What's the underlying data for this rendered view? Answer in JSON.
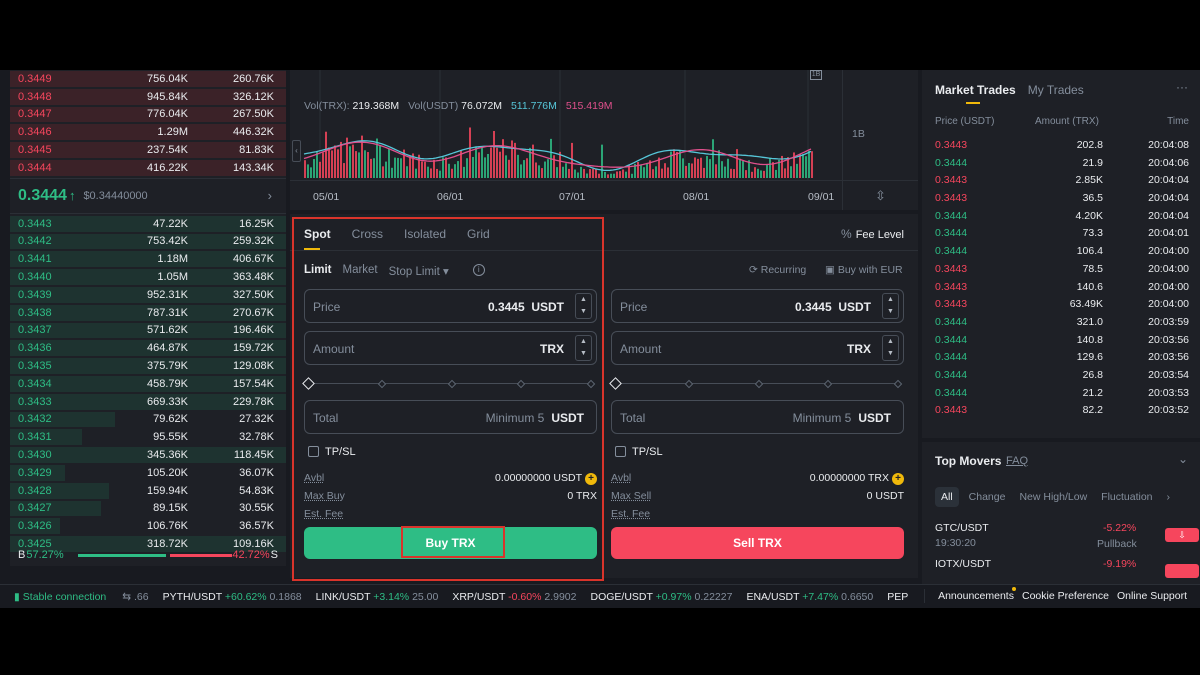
{
  "colors": {
    "buy": "#2ebd85",
    "sell": "#f6465d",
    "accent": "#f0b90b",
    "bg": "#181a20",
    "panel": "#1e2026",
    "highlight": "#d9342b"
  },
  "orderbook": {
    "asks": [
      {
        "price": "0.3449",
        "amount": "756.04K",
        "total": "260.76K",
        "depth": 1.0
      },
      {
        "price": "0.3448",
        "amount": "945.84K",
        "total": "326.12K",
        "depth": 1.0
      },
      {
        "price": "0.3447",
        "amount": "776.04K",
        "total": "267.50K",
        "depth": 1.0
      },
      {
        "price": "0.3446",
        "amount": "1.29M",
        "total": "446.32K",
        "depth": 1.0
      },
      {
        "price": "0.3445",
        "amount": "237.54K",
        "total": "81.83K",
        "depth": 1.0
      },
      {
        "price": "0.3444",
        "amount": "416.22K",
        "total": "143.34K",
        "depth": 1.0
      }
    ],
    "mid": {
      "price": "0.3444",
      "arrow": "↑",
      "usd": "$0.34440000",
      "chevron": "›"
    },
    "bids": [
      {
        "price": "0.3443",
        "amount": "47.22K",
        "total": "16.25K",
        "depth": 1.0
      },
      {
        "price": "0.3442",
        "amount": "753.42K",
        "total": "259.32K",
        "depth": 1.0
      },
      {
        "price": "0.3441",
        "amount": "1.18M",
        "total": "406.67K",
        "depth": 1.0
      },
      {
        "price": "0.3440",
        "amount": "1.05M",
        "total": "363.48K",
        "depth": 1.0
      },
      {
        "price": "0.3439",
        "amount": "952.31K",
        "total": "327.50K",
        "depth": 1.0
      },
      {
        "price": "0.3438",
        "amount": "787.31K",
        "total": "270.67K",
        "depth": 1.0
      },
      {
        "price": "0.3437",
        "amount": "571.62K",
        "total": "196.46K",
        "depth": 1.0
      },
      {
        "price": "0.3436",
        "amount": "464.87K",
        "total": "159.72K",
        "depth": 1.0
      },
      {
        "price": "0.3435",
        "amount": "375.79K",
        "total": "129.08K",
        "depth": 1.0
      },
      {
        "price": "0.3434",
        "amount": "458.79K",
        "total": "157.54K",
        "depth": 1.0
      },
      {
        "price": "0.3433",
        "amount": "669.33K",
        "total": "229.78K",
        "depth": 1.0
      },
      {
        "price": "0.3432",
        "amount": "79.62K",
        "total": "27.32K",
        "depth": 0.38
      },
      {
        "price": "0.3431",
        "amount": "95.55K",
        "total": "32.78K",
        "depth": 0.26
      },
      {
        "price": "0.3430",
        "amount": "345.36K",
        "total": "118.45K",
        "depth": 1.0
      },
      {
        "price": "0.3429",
        "amount": "105.20K",
        "total": "36.07K",
        "depth": 0.2
      },
      {
        "price": "0.3428",
        "amount": "159.94K",
        "total": "54.83K",
        "depth": 0.36
      },
      {
        "price": "0.3427",
        "amount": "89.15K",
        "total": "30.55K",
        "depth": 0.33
      },
      {
        "price": "0.3426",
        "amount": "106.76K",
        "total": "36.57K",
        "depth": 0.18
      },
      {
        "price": "0.3425",
        "amount": "318.72K",
        "total": "109.16K",
        "depth": 1.0
      }
    ],
    "ratio": {
      "b_label": "B",
      "b_value": "57.27%",
      "s_value": "42.72%",
      "s_label": "S",
      "buy_share": 0.5727
    }
  },
  "chart": {
    "vol_label": "Vol(TRX):",
    "vol_value": "219.368M",
    "vol_usdt_label": "Vol(USDT)",
    "vol_usdt_value": "76.072M",
    "ma1": "511.776M",
    "ma2": "515.419M",
    "scale_label": "1B",
    "dates": [
      "05/01",
      "06/01",
      "07/01",
      "08/01",
      "09/01"
    ],
    "collapse_icon": "‹",
    "badge": "1B",
    "fit_icon": "⇳"
  },
  "trade": {
    "tabs": [
      "Spot",
      "Cross",
      "Isolated",
      "Grid"
    ],
    "fee_icon": "%",
    "fee_label": "Fee Level",
    "order_types": [
      "Limit",
      "Market",
      "Stop Limit ▾"
    ],
    "info_icon": "i",
    "recurring": "Recurring",
    "buy_with": "Buy with EUR",
    "recurring_icon": "⟳",
    "wallet_icon": "▣",
    "buy": {
      "price_label": "Price",
      "price_value": "0.3445",
      "price_unit": "USDT",
      "amount_label": "Amount",
      "amount_unit": "TRX",
      "total_label": "Total",
      "total_min": "Minimum 5",
      "total_unit": "USDT",
      "tpsl": "TP/SL",
      "avbl_label": "Avbl",
      "avbl_value": "0.00000000 USDT",
      "max_label": "Max Buy",
      "max_value": "0 TRX",
      "fee_label": "Est. Fee",
      "button": "Buy TRX"
    },
    "sell": {
      "price_label": "Price",
      "price_value": "0.3445",
      "price_unit": "USDT",
      "amount_label": "Amount",
      "amount_unit": "TRX",
      "total_label": "Total",
      "total_min": "Minimum 5",
      "total_unit": "USDT",
      "tpsl": "TP/SL",
      "avbl_label": "Avbl",
      "avbl_value": "0.00000000 TRX",
      "max_label": "Max Sell",
      "max_value": "0 USDT",
      "fee_label": "Est. Fee",
      "button": "Sell TRX"
    },
    "stepper": "▲\n▼",
    "plus_icon": "+"
  },
  "market_trades": {
    "tabs": [
      "Market Trades",
      "My Trades"
    ],
    "more_icon": "···",
    "headers": [
      "Price (USDT)",
      "Amount (TRX)",
      "Time"
    ],
    "rows": [
      {
        "price": "0.3443",
        "amount": "202.8",
        "time": "20:04:08",
        "side": "dn"
      },
      {
        "price": "0.3444",
        "amount": "21.9",
        "time": "20:04:06",
        "side": "up"
      },
      {
        "price": "0.3443",
        "amount": "2.85K",
        "time": "20:04:04",
        "side": "dn"
      },
      {
        "price": "0.3443",
        "amount": "36.5",
        "time": "20:04:04",
        "side": "dn"
      },
      {
        "price": "0.3444",
        "amount": "4.20K",
        "time": "20:04:04",
        "side": "up"
      },
      {
        "price": "0.3444",
        "amount": "73.3",
        "time": "20:04:01",
        "side": "up"
      },
      {
        "price": "0.3444",
        "amount": "106.4",
        "time": "20:04:00",
        "side": "up"
      },
      {
        "price": "0.3443",
        "amount": "78.5",
        "time": "20:04:00",
        "side": "dn"
      },
      {
        "price": "0.3443",
        "amount": "140.6",
        "time": "20:04:00",
        "side": "dn"
      },
      {
        "price": "0.3443",
        "amount": "63.49K",
        "time": "20:04:00",
        "side": "dn"
      },
      {
        "price": "0.3444",
        "amount": "321.0",
        "time": "20:03:59",
        "side": "up"
      },
      {
        "price": "0.3444",
        "amount": "140.8",
        "time": "20:03:56",
        "side": "up"
      },
      {
        "price": "0.3444",
        "amount": "129.6",
        "time": "20:03:56",
        "side": "up"
      },
      {
        "price": "0.3444",
        "amount": "26.8",
        "time": "20:03:54",
        "side": "up"
      },
      {
        "price": "0.3444",
        "amount": "21.2",
        "time": "20:03:53",
        "side": "up"
      },
      {
        "price": "0.3443",
        "amount": "82.2",
        "time": "20:03:52",
        "side": "dn"
      }
    ]
  },
  "top_movers": {
    "title": "Top Movers",
    "faq": "FAQ",
    "chevron": "⌄",
    "tabs": [
      "All",
      "Change",
      "New High/Low",
      "Fluctuation",
      "›"
    ],
    "rows": [
      {
        "pair": "GTC/USDT",
        "time": "19:30:20",
        "pct": "-5.22%",
        "tag": "Pullback",
        "pill": "⇩"
      },
      {
        "pair": "IOTX/USDT",
        "time": "",
        "pct": "-9.19%",
        "tag": "",
        "pill": ""
      }
    ]
  },
  "status": {
    "connection": "Stable connection",
    "signal_icon": "▮",
    "tune_icon": "⇆",
    "tune_value": ".66",
    "tickers": [
      {
        "pair": "PYTH/USDT",
        "pct": "+60.62%",
        "price": "0.1868",
        "dir": "up"
      },
      {
        "pair": "LINK/USDT",
        "pct": "+3.14%",
        "price": "25.00",
        "dir": "up"
      },
      {
        "pair": "XRP/USDT",
        "pct": "-0.60%",
        "price": "2.9902",
        "dir": "dn"
      },
      {
        "pair": "DOGE/USDT",
        "pct": "+0.97%",
        "price": "0.22227",
        "dir": "up"
      },
      {
        "pair": "ENA/USDT",
        "pct": "+7.47%",
        "price": "0.6650",
        "dir": "up"
      },
      {
        "pair": "PEP",
        "pct": "",
        "price": "",
        "dir": "up"
      }
    ],
    "links": [
      "Announcements",
      "Cookie Preference",
      "Online Support"
    ]
  }
}
